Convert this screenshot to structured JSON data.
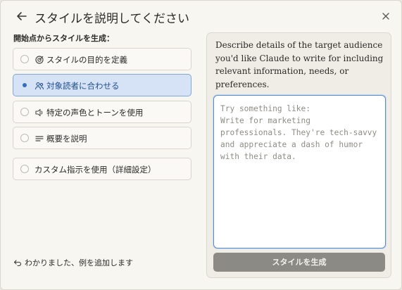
{
  "header": {
    "title": "スタイルを説明してください"
  },
  "left": {
    "section_label": "開始点からスタイルを生成：",
    "options": [
      {
        "label": "スタイルの目的を定義",
        "icon": "target-icon",
        "selected": false
      },
      {
        "label": "対象読者に合わせる",
        "icon": "audience-icon",
        "selected": true
      },
      {
        "label": "特定の声色とトーンを使用",
        "icon": "voice-icon",
        "selected": false
      },
      {
        "label": "概要を説明",
        "icon": "lines-icon",
        "selected": false
      },
      {
        "label": "カスタム指示を使用（詳細設定）",
        "icon": "",
        "selected": false
      }
    ],
    "footer_link": "わかりました、例を追加します"
  },
  "panel": {
    "description": "Describe details of the target audience you'd like Claude to write for including relevant information, needs, or preferences.",
    "textarea_placeholder": "Try something like:\nWrite for marketing professionals. They're tech-savvy and appreciate a dash of humor with their data.",
    "textarea_value": "",
    "generate_label": "スタイルを生成"
  },
  "colors": {
    "selected_bg": "#d6e3f7",
    "selected_border": "#7ea7dc",
    "selected_dot": "#2e6fc4",
    "button_bg": "#8c8a84"
  }
}
